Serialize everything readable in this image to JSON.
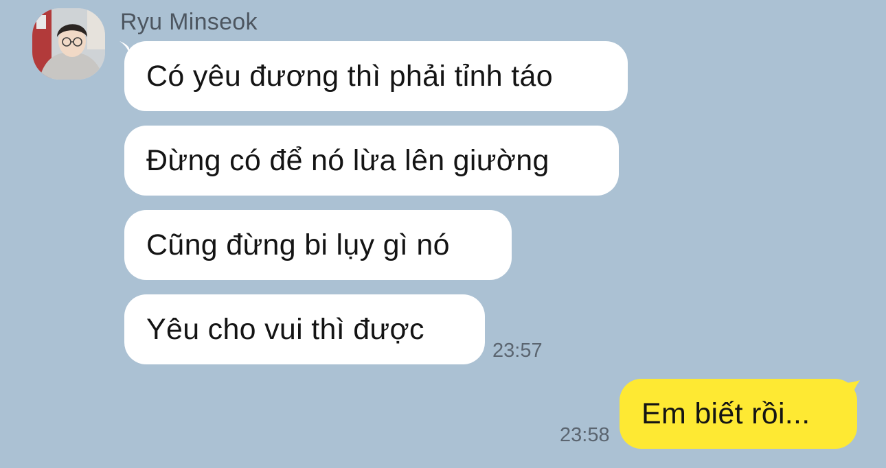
{
  "chat": {
    "incoming": {
      "sender_name": "Ryu Minseok",
      "avatar": "profile-photo",
      "messages": [
        {
          "text": "Có yêu đương thì phải tỉnh táo"
        },
        {
          "text": "Đừng có để nó lừa lên giường"
        },
        {
          "text": "Cũng đừng bi lụy gì nó"
        },
        {
          "text": "Yêu cho vui thì được"
        }
      ],
      "time": "23:57"
    },
    "outgoing": {
      "messages": [
        {
          "text": "Em biết rồi..."
        }
      ],
      "time": "23:58"
    }
  },
  "colors": {
    "background": "#abc1d3",
    "incoming_bubble": "#ffffff",
    "outgoing_bubble": "#fee933"
  }
}
